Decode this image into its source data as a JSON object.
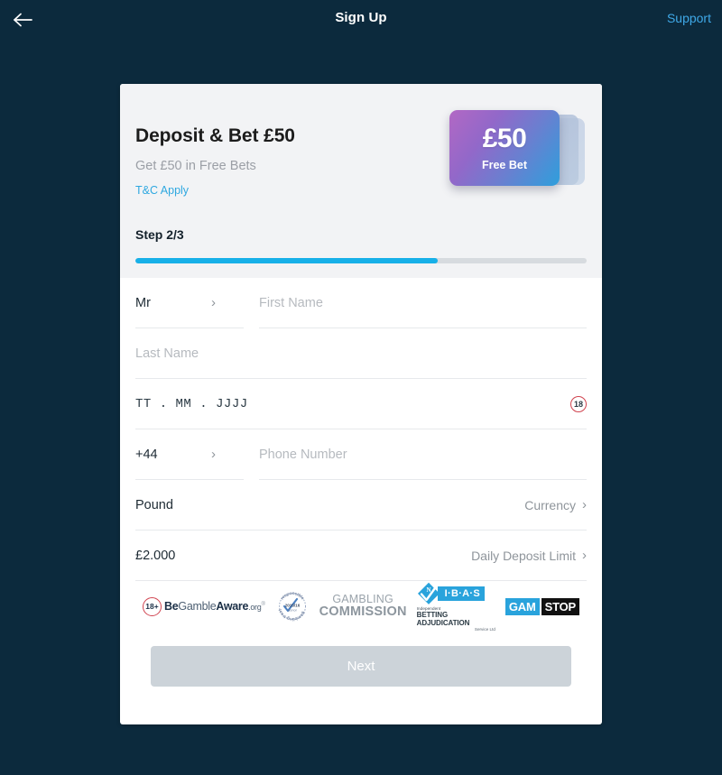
{
  "header": {
    "back_icon": "arrow-left-icon",
    "title": "Sign Up",
    "support_label": "Support"
  },
  "promo": {
    "title": "Deposit & Bet £50",
    "subtitle": "Get £50 in Free Bets",
    "terms_label": "T&C Apply",
    "step_label": "Step 2/3",
    "progress_percent": 67,
    "ticket": {
      "amount": "£50",
      "caption": "Free Bet"
    }
  },
  "form": {
    "title_select": {
      "value": "Mr",
      "chevron": "chevron-right-icon"
    },
    "first_name": {
      "value": "",
      "placeholder": "First Name"
    },
    "last_name": {
      "value": "",
      "placeholder": "Last Name"
    },
    "date_of_birth": {
      "value": "TT . MM . JJJJ",
      "age_badge": "18"
    },
    "country_code": {
      "value": "+44",
      "chevron": "chevron-right-icon"
    },
    "phone": {
      "value": "",
      "placeholder": "Phone Number"
    },
    "currency": {
      "value": "Pound",
      "label": "Currency",
      "chevron": "chevron-right-icon"
    },
    "daily_deposit_limit": {
      "value": "£2.000",
      "label": "Daily Deposit Limit",
      "chevron": "chevron-right-icon"
    }
  },
  "logos": {
    "begambleaware": {
      "badge": "18+",
      "name_part1": "Be",
      "name_part2": "Gamble",
      "name_part3": "Aware",
      "suffix": ".org"
    },
    "responsible_gambling_trust": {
      "top_text": "responsible",
      "bottom_text": "gambling trust",
      "year": "2015/16",
      "role": "donor"
    },
    "gambling_commission": {
      "line1": "GAMBLING",
      "line2": "COMMISSION"
    },
    "ibas": {
      "acronym": "I·B·A·S",
      "line1": "Independent",
      "line2": "BETTING ADJUDICATION",
      "line3": "Service Ltd"
    },
    "gamstop": {
      "part1": "GAM",
      "part2": "STOP"
    }
  },
  "footer": {
    "next_label": "Next"
  },
  "colors": {
    "page_background": "#0c2a3d",
    "accent_blue": "#17b0e8",
    "link_blue": "#3fa9e8",
    "disabled_button": "#ccd3d9",
    "badge_red": "#d0434f"
  }
}
